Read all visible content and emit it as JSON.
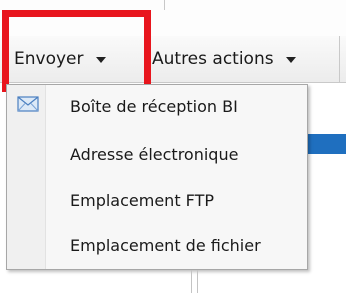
{
  "toolbar": {
    "send_label": "Envoyer",
    "other_actions_label": "Autres actions"
  },
  "send_menu": {
    "items": [
      {
        "label": "Boîte de réception BI",
        "icon": "envelope-icon"
      },
      {
        "label": "Adresse électronique"
      },
      {
        "label": "Emplacement FTP"
      },
      {
        "label": "Emplacement de fichier"
      }
    ]
  },
  "colors": {
    "highlight": "#e8151d",
    "selection_blue": "#1f6fbf"
  }
}
